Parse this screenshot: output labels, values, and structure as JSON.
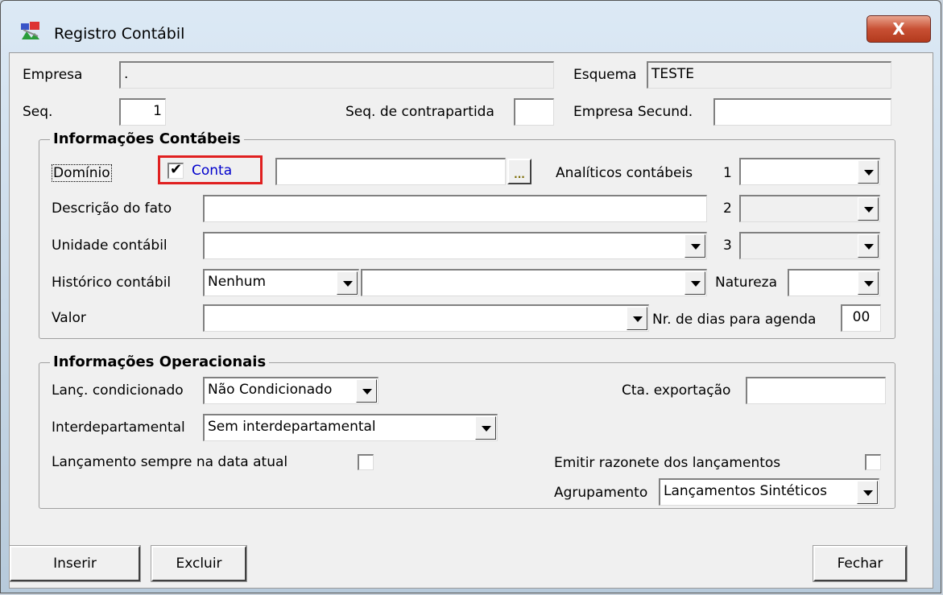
{
  "window": {
    "title": "Registro Contábil",
    "close_label": "X"
  },
  "header": {
    "empresa_label": "Empresa",
    "empresa_value": ".",
    "esquema_label": "Esquema",
    "esquema_value": "TESTE",
    "seq_label": "Seq.",
    "seq_value": "1",
    "seq_contrapartida_label": "Seq. de contrapartida",
    "seq_contrapartida_value": "",
    "empresa_secund_label": "Empresa Secund.",
    "empresa_secund_value": ""
  },
  "contabeis": {
    "group_title": "Informações Contábeis",
    "dominio_label": "Domínio",
    "conta_checkbox_label": "Conta",
    "conta_checked": true,
    "conta_value": "",
    "lookup_button_label": "...",
    "analiticos_label": "Analíticos contábeis",
    "analiticos": [
      {
        "index": "1",
        "value": ""
      },
      {
        "index": "2",
        "value": ""
      },
      {
        "index": "3",
        "value": ""
      }
    ],
    "descricao_label": "Descrição do fato",
    "descricao_value": "",
    "unidade_label": "Unidade contábil",
    "unidade_value": "",
    "historico_label": "Histórico contábil",
    "historico_value": "Nenhum",
    "historico_texto_value": "",
    "natureza_label": "Natureza",
    "natureza_value": "",
    "valor_label": "Valor",
    "valor_value": "",
    "dias_agenda_label": "Nr. de dias para agenda",
    "dias_agenda_value": "00"
  },
  "operacionais": {
    "group_title": "Informações Operacionais",
    "lanc_condicionado_label": "Lanç. condicionado",
    "lanc_condicionado_value": "Não Condicionado",
    "cta_exportacao_label": "Cta. exportação",
    "cta_exportacao_value": "",
    "interdepartamental_label": "Interdepartamental",
    "interdepartamental_value": "Sem interdepartamental",
    "lancamento_data_atual_label": "Lançamento sempre na data atual",
    "lancamento_data_atual_checked": false,
    "emitir_razonete_label": "Emitir razonete dos lançamentos",
    "emitir_razonete_checked": false,
    "agrupamento_label": "Agrupamento",
    "agrupamento_value": "Lançamentos Sintéticos"
  },
  "buttons": {
    "inserir": {
      "label": "Inserir"
    },
    "excluir": {
      "label": "Excluir"
    },
    "fechar": {
      "label": "Fechar"
    }
  },
  "colors": {
    "highlight": "#e02020",
    "conta_text": "#0000cc",
    "close_button": "#c85034"
  }
}
